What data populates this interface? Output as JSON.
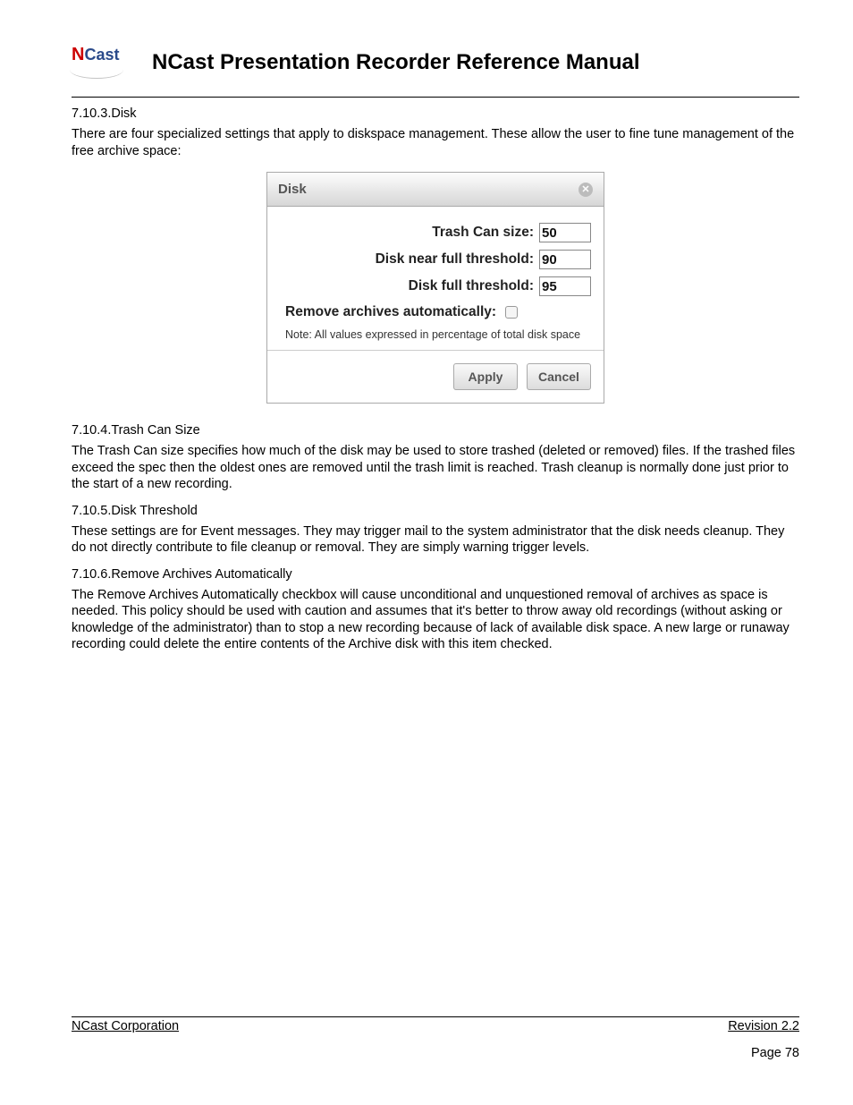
{
  "header": {
    "logo_n": "N",
    "logo_rest": "Cast",
    "title": "NCast Presentation Recorder Reference Manual"
  },
  "sections": {
    "s1_num": "7.10.3.",
    "s1_title": "Disk",
    "s1_para": "There are four specialized settings that apply to diskspace management. These allow the user to fine tune management of the free archive space:",
    "s2_num": "7.10.4.",
    "s2_title": "Trash Can Size",
    "s2_para": "The Trash Can size specifies how much of the disk may be used to store trashed (deleted or removed) files. If the trashed files exceed the spec then the oldest ones are removed until the trash limit is reached. Trash cleanup is normally done just prior to the start of a new recording.",
    "s3_num": "7.10.5.",
    "s3_title": "Disk Threshold",
    "s3_para": "These settings are for Event messages. They may trigger mail to the system administrator that the disk needs cleanup. They do not directly contribute to file cleanup or removal. They are simply warning trigger levels.",
    "s4_num": "7.10.6.",
    "s4_title": "Remove Archives Automatically",
    "s4_para": "The Remove Archives Automatically checkbox will cause unconditional and unquestioned removal of archives as space is needed. This policy should be used with caution and assumes that it's better to throw away old recordings (without asking or knowledge of the administrator) than to stop a new recording because of lack of available disk space. A new large or runaway recording could delete the entire contents of the Archive disk with this item checked."
  },
  "dialog": {
    "title": "Disk",
    "close_glyph": "✕",
    "fields": {
      "trash_label": "Trash Can size:",
      "trash_value": "50",
      "near_label": "Disk near full threshold:",
      "near_value": "90",
      "full_label": "Disk full threshold:",
      "full_value": "95",
      "remove_label": "Remove archives automatically:"
    },
    "note": "Note: All values expressed in percentage of total disk space",
    "apply": "Apply",
    "cancel": "Cancel"
  },
  "footer": {
    "left": "NCast Corporation",
    "right": "Revision 2.2",
    "page": "Page 78"
  }
}
